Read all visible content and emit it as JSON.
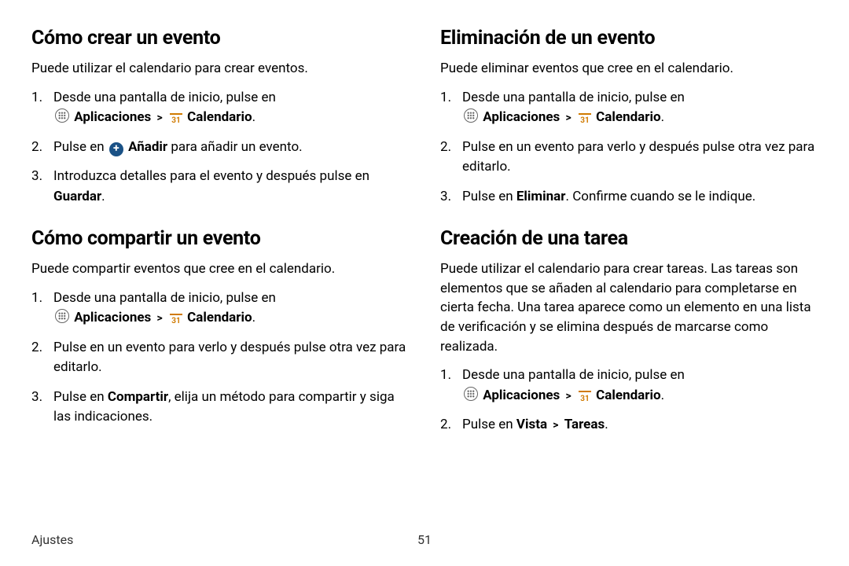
{
  "footer": {
    "section": "Ajustes",
    "page": "51"
  },
  "glyphs": {
    "chev": ">"
  },
  "left": {
    "sec1": {
      "heading": "Cómo crear un evento",
      "intro": "Puede utilizar el calendario para crear eventos.",
      "step1_pre": "Desde una pantalla de inicio, pulse en ",
      "apps": "Aplicaciones",
      "cal": "Calendario",
      "period": ".",
      "step2_pre": "Pulse en ",
      "step2_add": "Añadir",
      "step2_post": " para añadir un evento.",
      "step3_pre": "Introduzca detalles para el evento y después pulse en ",
      "step3_save": "Guardar",
      "step3_post": "."
    },
    "sec2": {
      "heading": "Cómo compartir un evento",
      "intro": "Puede compartir eventos que cree en el calendario.",
      "step1_pre": "Desde una pantalla de inicio, pulse en ",
      "apps": "Aplicaciones",
      "cal": "Calendario",
      "period": ".",
      "step2": "Pulse en un evento para verlo y después pulse otra vez para editarlo.",
      "step3_pre": "Pulse en ",
      "step3_share": "Compartir",
      "step3_post": ", elija un método para compartir y siga las indicaciones."
    }
  },
  "right": {
    "sec1": {
      "heading": "Eliminación de un evento",
      "intro": "Puede eliminar eventos que cree en el calendario.",
      "step1_pre": "Desde una pantalla de inicio, pulse en ",
      "apps": "Aplicaciones",
      "cal": "Calendario",
      "period": ".",
      "step2": "Pulse en un evento para verlo y después pulse otra vez para editarlo.",
      "step3_pre": "Pulse en ",
      "step3_del": "Eliminar",
      "step3_post": ". Confirme cuando se le indique."
    },
    "sec2": {
      "heading": "Creación de una tarea",
      "intro": "Puede utilizar el calendario para crear tareas. Las tareas son elementos que se añaden al calendario para completarse en cierta fecha. Una tarea aparece como un elemento en una lista de verificación y se elimina después de marcarse como realizada.",
      "step1_pre": "Desde una pantalla de inicio, pulse en ",
      "apps": "Aplicaciones",
      "cal": "Calendario",
      "period": ".",
      "step2_pre": "Pulse en ",
      "step2_view": "Vista",
      "step2_tasks": "Tareas",
      "step2_post": "."
    }
  }
}
